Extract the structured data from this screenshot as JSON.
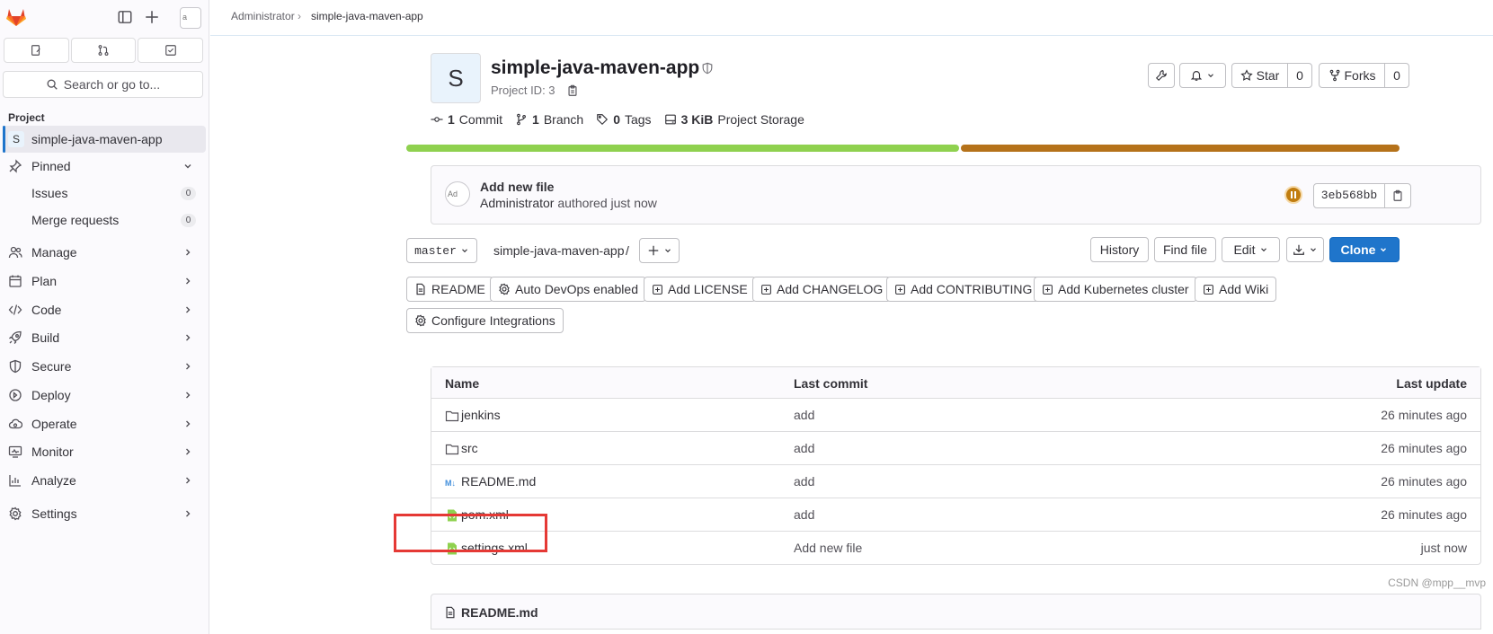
{
  "topbar": {
    "breadcrumb": [
      "Administrator",
      "simple-java-maven-app"
    ]
  },
  "sidebar": {
    "avatar_alt": "a",
    "search_placeholder": "Search or go to...",
    "section_label": "Project",
    "project_initial": "S",
    "project_name": "simple-java-maven-app",
    "pinned_label": "Pinned",
    "pinned_items": [
      {
        "label": "Issues",
        "count": "0"
      },
      {
        "label": "Merge requests",
        "count": "0"
      }
    ],
    "items": [
      {
        "label": "Manage",
        "icon": "users-icon"
      },
      {
        "label": "Plan",
        "icon": "calendar-icon"
      },
      {
        "label": "Code",
        "icon": "code-icon"
      },
      {
        "label": "Build",
        "icon": "rocket-icon"
      },
      {
        "label": "Secure",
        "icon": "shield-icon"
      },
      {
        "label": "Deploy",
        "icon": "deploy-icon"
      },
      {
        "label": "Operate",
        "icon": "cloud-icon"
      },
      {
        "label": "Monitor",
        "icon": "monitor-icon"
      },
      {
        "label": "Analyze",
        "icon": "chart-icon"
      },
      {
        "label": "Settings",
        "icon": "settings-icon"
      }
    ]
  },
  "project": {
    "initial": "S",
    "title": "simple-java-maven-app",
    "id_text": "Project ID: 3",
    "star_label": "Star",
    "star_count": "0",
    "forks_label": "Forks",
    "forks_count": "0",
    "stats": {
      "commits_value": "1",
      "commits_label": "Commit",
      "branches_value": "1",
      "branches_label": "Branch",
      "tags_value": "0",
      "tags_label": "Tags",
      "storage_value": "3 KiB",
      "storage_label": "Project Storage"
    },
    "language_bar": [
      {
        "color": "#8fd14f",
        "fraction": 0.558
      },
      {
        "color": "#b5721a",
        "fraction": 0.442
      }
    ]
  },
  "commit": {
    "avatar_alt": "Ad",
    "title": "Add new file",
    "author": "Administrator",
    "authored_text": "authored just now",
    "sha": "3eb568bb",
    "status_color": "#c17d10"
  },
  "repo": {
    "branch": "master",
    "path": "simple-java-maven-app",
    "path_sep": "/",
    "history": "History",
    "find_file": "Find file",
    "edit": "Edit",
    "clone": "Clone"
  },
  "quick_actions": [
    {
      "label": "README",
      "icon": "doc-icon"
    },
    {
      "label": "Auto DevOps enabled",
      "icon": "settings-icon"
    },
    {
      "label": "Add LICENSE",
      "icon": "plus-square-icon"
    },
    {
      "label": "Add CHANGELOG",
      "icon": "plus-square-icon"
    },
    {
      "label": "Add CONTRIBUTING",
      "icon": "plus-square-icon"
    },
    {
      "label": "Add Kubernetes cluster",
      "icon": "plus-square-icon"
    },
    {
      "label": "Add Wiki",
      "icon": "plus-square-icon"
    },
    {
      "label": "Configure Integrations",
      "icon": "settings-icon"
    }
  ],
  "files": {
    "headers": {
      "name": "Name",
      "last_commit": "Last commit",
      "last_update": "Last update"
    },
    "rows": [
      {
        "name": "jenkins",
        "type": "folder",
        "commit": "add",
        "time": "26 minutes ago"
      },
      {
        "name": "src",
        "type": "folder",
        "commit": "add",
        "time": "26 minutes ago"
      },
      {
        "name": "README.md",
        "type": "markdown",
        "commit": "add",
        "time": "26 minutes ago"
      },
      {
        "name": "pom.xml",
        "type": "xml",
        "commit": "add",
        "time": "26 minutes ago"
      },
      {
        "name": "settings.xml",
        "type": "xml",
        "commit": "Add new file",
        "time": "just now"
      }
    ]
  },
  "readme": {
    "title": "README.md"
  },
  "watermark": "CSDN @mpp__mvp",
  "colors": {
    "accent": "#1f75cb",
    "highlight": "#e53935"
  }
}
